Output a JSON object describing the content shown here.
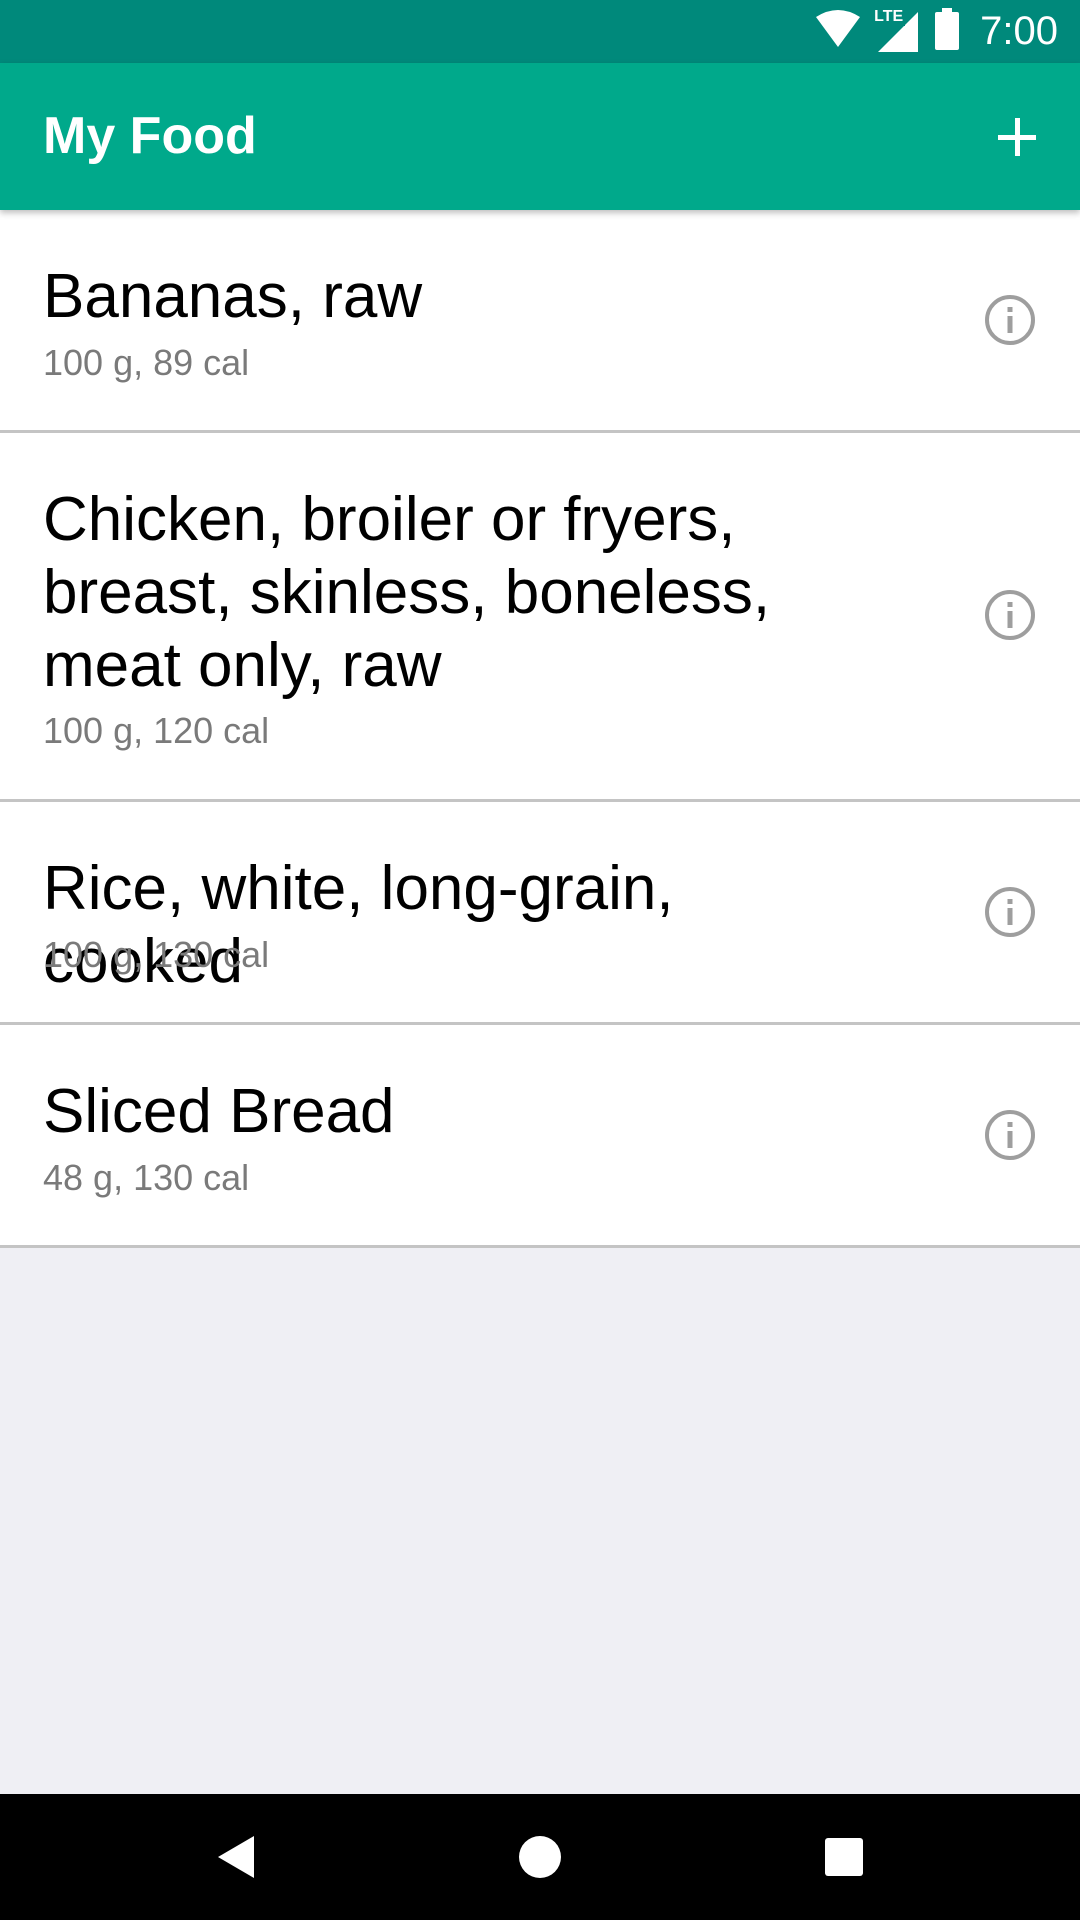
{
  "status_bar": {
    "time": "7:00",
    "network_label": "LTE",
    "icons": [
      "wifi-icon",
      "lte-signal-icon",
      "battery-icon"
    ]
  },
  "app_bar": {
    "title": "My Food",
    "add_icon": "plus-icon"
  },
  "foods": [
    {
      "name": "Bananas, raw",
      "detail": "100 g, 89 cal"
    },
    {
      "name": "Chicken, broiler or fryers, breast, skinless, boneless, meat only, raw",
      "detail": "100 g, 120 cal"
    },
    {
      "name": "Rice, white, long-grain, cooked",
      "detail": "100 g, 130 cal"
    },
    {
      "name": "Sliced Bread",
      "detail": "48 g, 130 cal"
    }
  ],
  "nav_bar": {
    "icons": [
      "back-icon",
      "home-icon",
      "recents-icon"
    ]
  },
  "colors": {
    "status_bar": "#00897b",
    "app_bar": "#00a98b",
    "background": "#efeff4",
    "divider": "#c4c4c4",
    "detail_text": "#7a7a7a",
    "info_icon": "#9e9e9e"
  }
}
